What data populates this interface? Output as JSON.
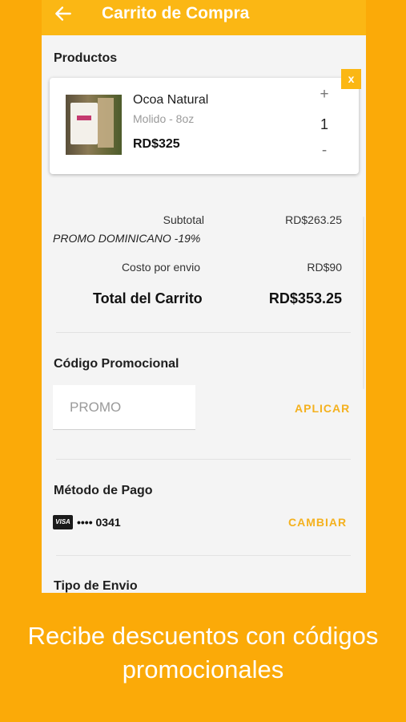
{
  "app_bar": {
    "title": "Carrito de Compra",
    "back_icon": "arrow-left-icon"
  },
  "products": {
    "title": "Productos",
    "remove_label": "x",
    "items": [
      {
        "name": "Ocoa Natural",
        "variant": "Molido - 8oz",
        "price": "RD$325",
        "quantity": "1",
        "increment_label": "+",
        "decrement_label": "-"
      }
    ]
  },
  "summary": {
    "subtotal_label": "Subtotal",
    "subtotal_value": "RD$263.25",
    "promo_text": "PROMO DOMINICANO -19%",
    "shipping_label": "Costo por envio",
    "shipping_value": "RD$90",
    "total_label": "Total del Carrito",
    "total_value": "RD$353.25"
  },
  "promo_code": {
    "title": "Código Promocional",
    "placeholder": "PROMO",
    "value": "",
    "apply_label": "APLICAR"
  },
  "payment": {
    "title": "Método de Pago",
    "card_brand": "VISA",
    "card_number": "•••• 0341",
    "change_label": "CAMBIAR"
  },
  "shipping_type": {
    "title": "Tipo de Envio"
  },
  "caption": {
    "line1": "Recibe descuentos con códigos",
    "line2": "promocionales"
  },
  "colors": {
    "background": "#FBAA08",
    "app_bar": "#FBB714",
    "accent_link": "#F4B11E",
    "screen": "#F4F4F4"
  }
}
